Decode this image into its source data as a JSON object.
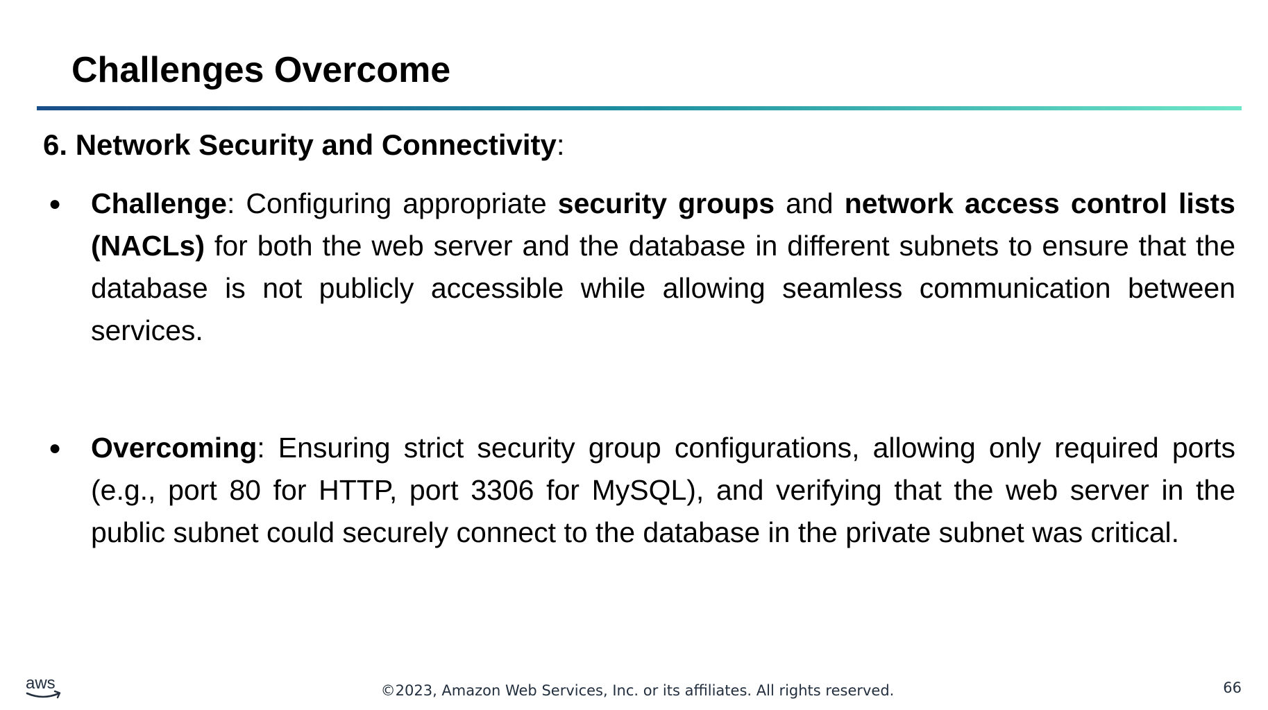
{
  "slide": {
    "title": "Challenges Overcome",
    "accent_gradient": [
      "#1a4e8a",
      "#1e8fa0",
      "#6ee6c8"
    ]
  },
  "section": {
    "heading_bold": "6. Network Security and Connectivity",
    "heading_suffix": ":"
  },
  "bullets": [
    {
      "marker": "●",
      "segments": [
        {
          "text": "Challenge",
          "bold": true
        },
        {
          "text": ": Configuring appropriate ",
          "bold": false
        },
        {
          "text": "security groups",
          "bold": true
        },
        {
          "text": " and ",
          "bold": false
        },
        {
          "text": "network access control lists (NACLs)",
          "bold": true
        },
        {
          "text": " for both the web server and the database in different subnets to ensure that the database is not publicly accessible while allowing seamless communication between services.",
          "bold": false
        }
      ]
    },
    {
      "marker": "●",
      "segments": [
        {
          "text": "Overcoming",
          "bold": true
        },
        {
          "text": ": Ensuring strict security group configurations, allowing only required ports (e.g., port 80 for HTTP, port 3306 for MySQL), and verifying that the web server in the public subnet could securely connect to the database in the private subnet was critical.",
          "bold": false
        }
      ]
    }
  ],
  "footer": {
    "logo_text": "aws",
    "copyright": "©2023, Amazon Web Services, Inc. or its affiliates. All rights reserved.",
    "page_number": "66"
  }
}
